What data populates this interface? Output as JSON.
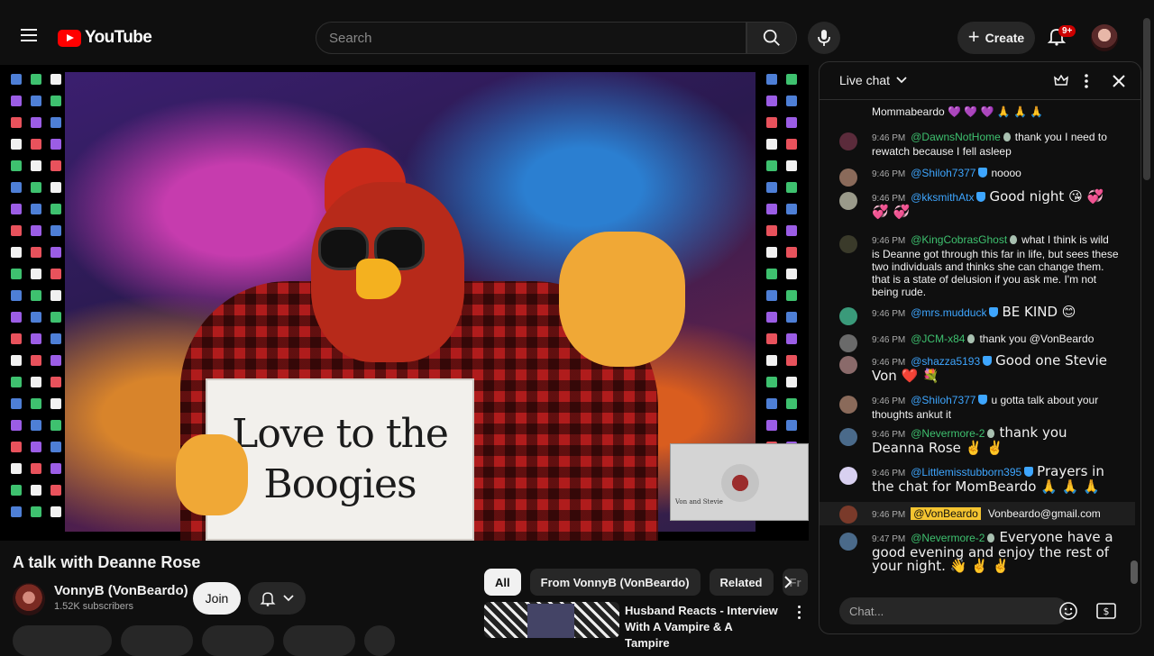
{
  "header": {
    "logo_text": "YouTube",
    "search_placeholder": "Search",
    "create_label": "Create",
    "notification_count": "9+"
  },
  "video": {
    "sign_line1": "Love to the",
    "sign_line2": "Boogies",
    "pip_label": "Von and Stevie",
    "title": "A talk with Deanne Rose",
    "channel_name": "VonnyB (VonBeardo)",
    "subscribers": "1.52K subscribers",
    "join_label": "Join"
  },
  "chips": [
    {
      "label": "All"
    },
    {
      "label": "From VonnyB (VonBeardo)"
    },
    {
      "label": "Related"
    },
    {
      "label": "Fr"
    }
  ],
  "related": {
    "title": "Husband Reacts - Interview With A Vampire & A Tampire"
  },
  "chat": {
    "title": "Live chat",
    "input_placeholder": "Chat...",
    "messages": [
      {
        "time": "",
        "user": "",
        "text": "Mommabeardo 💜 💜 💜 🙏 🙏 🙏"
      },
      {
        "time": "9:46 PM",
        "user": "@DawnsNotHome",
        "text": "thank you I need to rewatch because I fell asleep"
      },
      {
        "time": "9:46 PM",
        "user": "@Shiloh7377",
        "text": "noooo"
      },
      {
        "time": "9:46 PM",
        "user": "@kksmithAtx",
        "text": "Good night 😘 💞 💞 💞"
      },
      {
        "time": "9:46 PM",
        "user": "@KingCobrasGhost",
        "text": "what I think is wild is Deanne got through this far in life, but sees these two individuals and thinks she can change them. that is a state of delusion if you ask me. I'm not being rude."
      },
      {
        "time": "9:46 PM",
        "user": "@mrs.mudduck",
        "text": "BE KIND 😊"
      },
      {
        "time": "9:46 PM",
        "user": "@JCM-x84",
        "text": "thank you @VonBeardo"
      },
      {
        "time": "9:46 PM",
        "user": "@shazza5193",
        "text": "Good one Stevie Von ❤️ 💐"
      },
      {
        "time": "9:46 PM",
        "user": "@Shiloh7377",
        "text": "u gotta talk about your thoughts ankut it"
      },
      {
        "time": "9:46 PM",
        "user": "@Nevermore-2",
        "text": "thank you Deanna Rose ✌️ ✌️"
      },
      {
        "time": "9:46 PM",
        "user": "@Littlemisstubborn395",
        "text": "Prayers in the chat for MomBeardo 🙏 🙏 🙏"
      },
      {
        "time": "9:46 PM",
        "user": "@VonBeardo",
        "text": "Vonbeardo@gmail.com"
      },
      {
        "time": "9:47 PM",
        "user": "@Nevermore-2",
        "text": "Everyone have a good evening and enjoy the rest of your night. 👋 ✌️ ✌️"
      }
    ]
  },
  "colors": {
    "brand_red": "#ff0000",
    "link_blue": "#3ea6ff",
    "member_green": "#3ec16f",
    "owner_highlight": "#f4c430"
  }
}
